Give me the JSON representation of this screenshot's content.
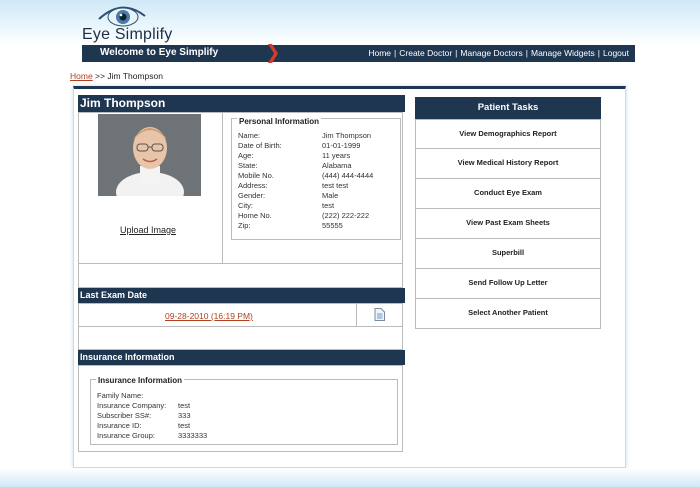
{
  "app": {
    "logo_text": "Eye Simplify"
  },
  "nav": {
    "welcome": "Welcome to Eye Simplify",
    "links": [
      "Home",
      "Create Doctor",
      "Manage Doctors",
      "Manage Widgets",
      "Logout"
    ]
  },
  "breadcrumb": {
    "home": "Home",
    "sep": " >> ",
    "current": "Jim Thompson"
  },
  "patient": {
    "name": "Jim Thompson",
    "upload_label": "Upload Image",
    "personal_legend": "Personal Information",
    "fields": [
      {
        "label": "Name:",
        "value": "Jim Thompson"
      },
      {
        "label": "Date of Birth:",
        "value": "01-01-1999"
      },
      {
        "label": "Age:",
        "value": "11 years"
      },
      {
        "label": "State:",
        "value": "Alabama"
      },
      {
        "label": "Mobile No.",
        "value": "(444) 444-4444"
      },
      {
        "label": "Address:",
        "value": "test test"
      },
      {
        "label": "Gender:",
        "value": "Male"
      },
      {
        "label": "City:",
        "value": "test"
      },
      {
        "label": "Home No.",
        "value": "(222) 222-222"
      },
      {
        "label": "Zip:",
        "value": "55555"
      }
    ]
  },
  "tasks": {
    "title": "Patient Tasks",
    "items": [
      "View Demographics Report",
      "View Medical History Report",
      "Conduct Eye Exam",
      "View Past Exam Sheets",
      "Superbill",
      "Send Follow Up Letter",
      "Select Another Patient"
    ]
  },
  "last_exam": {
    "title": "Last Exam Date",
    "value": "09-28-2010 (16:19 PM)"
  },
  "insurance": {
    "title": "Insurance Information",
    "legend": "Insurance Information",
    "fields": [
      {
        "label": "Family Name:",
        "value": ""
      },
      {
        "label": "Insurance Company:",
        "value": "test"
      },
      {
        "label": "Subscriber SS#:",
        "value": "333"
      },
      {
        "label": "Insurance ID:",
        "value": "test"
      },
      {
        "label": "Insurance Group:",
        "value": "3333333"
      }
    ]
  },
  "colors": {
    "nav_bg": "#1e3650",
    "accent_red": "#b04020",
    "band": "#cfe9f7"
  }
}
